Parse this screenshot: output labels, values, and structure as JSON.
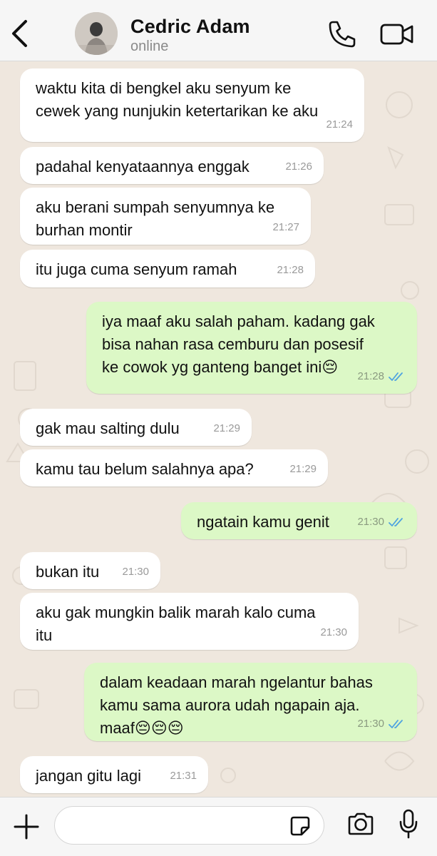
{
  "header": {
    "contact_name": "Cedric Adam",
    "status": "online",
    "back_icon": "chevron-left-icon",
    "call_icon": "phone-icon",
    "video_icon": "video-camera-icon"
  },
  "messages": [
    {
      "direction": "in",
      "text": "waktu kita di bengkel aku senyum ke\ncewek yang nunjukin ketertarikan ke aku",
      "time": "21:24"
    },
    {
      "direction": "in",
      "text": "padahal kenyataannya enggak",
      "time": "21:26"
    },
    {
      "direction": "in",
      "text": "aku berani sumpah senyumnya ke\nburhan montir",
      "time": "21:27"
    },
    {
      "direction": "in",
      "text": "itu juga cuma senyum ramah",
      "time": "21:28"
    },
    {
      "direction": "out",
      "text": "iya maaf aku salah paham. kadang gak\nbisa nahan rasa cemburu dan posesif\nke cowok yg ganteng banget ini😔",
      "time": "21:28",
      "read": true
    },
    {
      "direction": "in",
      "text": "gak mau salting dulu",
      "time": "21:29"
    },
    {
      "direction": "in",
      "text": "kamu tau belum salahnya apa?",
      "time": "21:29"
    },
    {
      "direction": "out",
      "text": "ngatain kamu genit",
      "time": "21:30",
      "read": true
    },
    {
      "direction": "in",
      "text": "bukan itu",
      "time": "21:30"
    },
    {
      "direction": "in",
      "text": "aku gak mungkin balik marah kalo cuma\nitu",
      "time": "21:30"
    },
    {
      "direction": "out",
      "text": "dalam keadaan marah ngelantur bahas\nkamu sama aurora udah ngapain aja.\nmaaf😔😔😔",
      "time": "21:30",
      "read": true
    },
    {
      "direction": "in",
      "text": "jangan gitu lagi",
      "time": "21:31"
    }
  ],
  "footer": {
    "input_value": "",
    "input_placeholder": "",
    "plus_icon": "plus-icon",
    "sticker_icon": "sticker-icon",
    "camera_icon": "camera-icon",
    "mic_icon": "microphone-icon"
  },
  "colors": {
    "chat_background": "#efe7de",
    "incoming_bubble": "#ffffff",
    "outgoing_bubble": "#dcf8c6",
    "read_ticks": "#4fa3e0",
    "accent_icons": "#111111"
  }
}
